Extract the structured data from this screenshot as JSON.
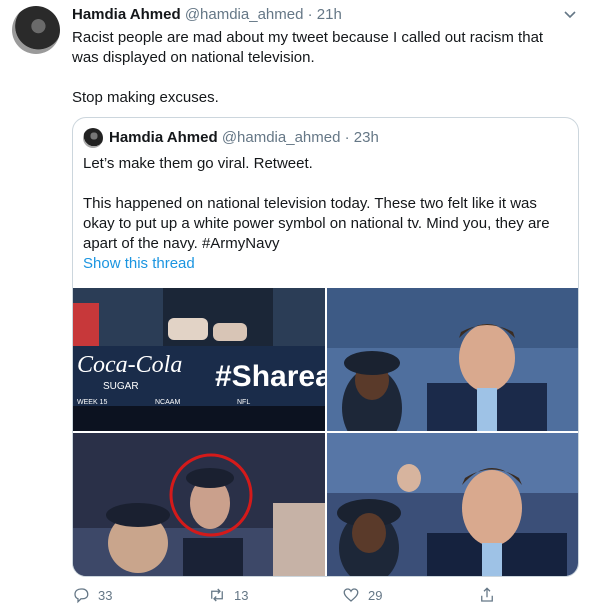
{
  "tweet": {
    "author_name": "Hamdia Ahmed",
    "handle_time": "@hamdia_ahmed · 21h",
    "line1": "Racist people are mad about my tweet because I called out racism that",
    "line2": "was displayed on national television.",
    "line3": "Stop making excuses."
  },
  "quoted": {
    "author_name": "Hamdia Ahmed",
    "handle_time": "@hamdia_ahmed · 23h",
    "para1": "Let’s make them go viral. Retweet.",
    "para2_l1": "This happened on national television today. These two felt like it was",
    "para2_l2": "okay to put up a white power symbol on national tv. Mind you, they are",
    "para2_l3": "apart of the navy. #ArmyNavy",
    "show_thread": "Show this thread",
    "image1_overlay": {
      "brand": "Coca-Cola",
      "sugar": "SUGAR",
      "hashtag": "#Sharea",
      "ticker": [
        "WEEK 15",
        "NCAAM",
        "NFL"
      ]
    }
  },
  "actions": {
    "reply_count": "33",
    "retweet_count": "13",
    "like_count": "29",
    "share_label": ""
  },
  "colors": {
    "link": "#1b95e0",
    "muted": "#657786",
    "border": "#ccd6dd"
  },
  "icons": [
    "chevron-down-icon",
    "reply-icon",
    "retweet-icon",
    "like-icon",
    "share-icon"
  ]
}
